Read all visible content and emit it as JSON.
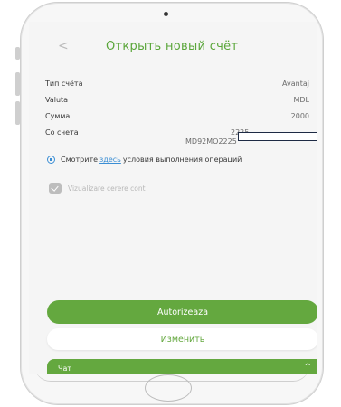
{
  "header": {
    "back_icon": "chevron-left",
    "title": "Открыть новый счёт"
  },
  "summary": {
    "account_type": {
      "label": "Тип счёта",
      "value": "Avantaj"
    },
    "currency": {
      "label": "Valuta",
      "value": "MDL"
    },
    "amount": {
      "label": "Сумма",
      "value": "2000"
    },
    "source_account": {
      "label": "Со счета",
      "line1": "2225",
      "line2": "MD92MO2225"
    }
  },
  "info": {
    "before": "Смотрите",
    "link": "здесь",
    "after": "условия выполнения операций"
  },
  "checkbox": {
    "label": "Vizualizare cerere cont",
    "checked": true
  },
  "buttons": {
    "authorize": "Autorizeaza",
    "change": "Изменить"
  },
  "chat": {
    "label": "Чат",
    "icon": "chevron-up"
  },
  "colors": {
    "accent": "#64a83f",
    "link": "#3b8ed4"
  }
}
